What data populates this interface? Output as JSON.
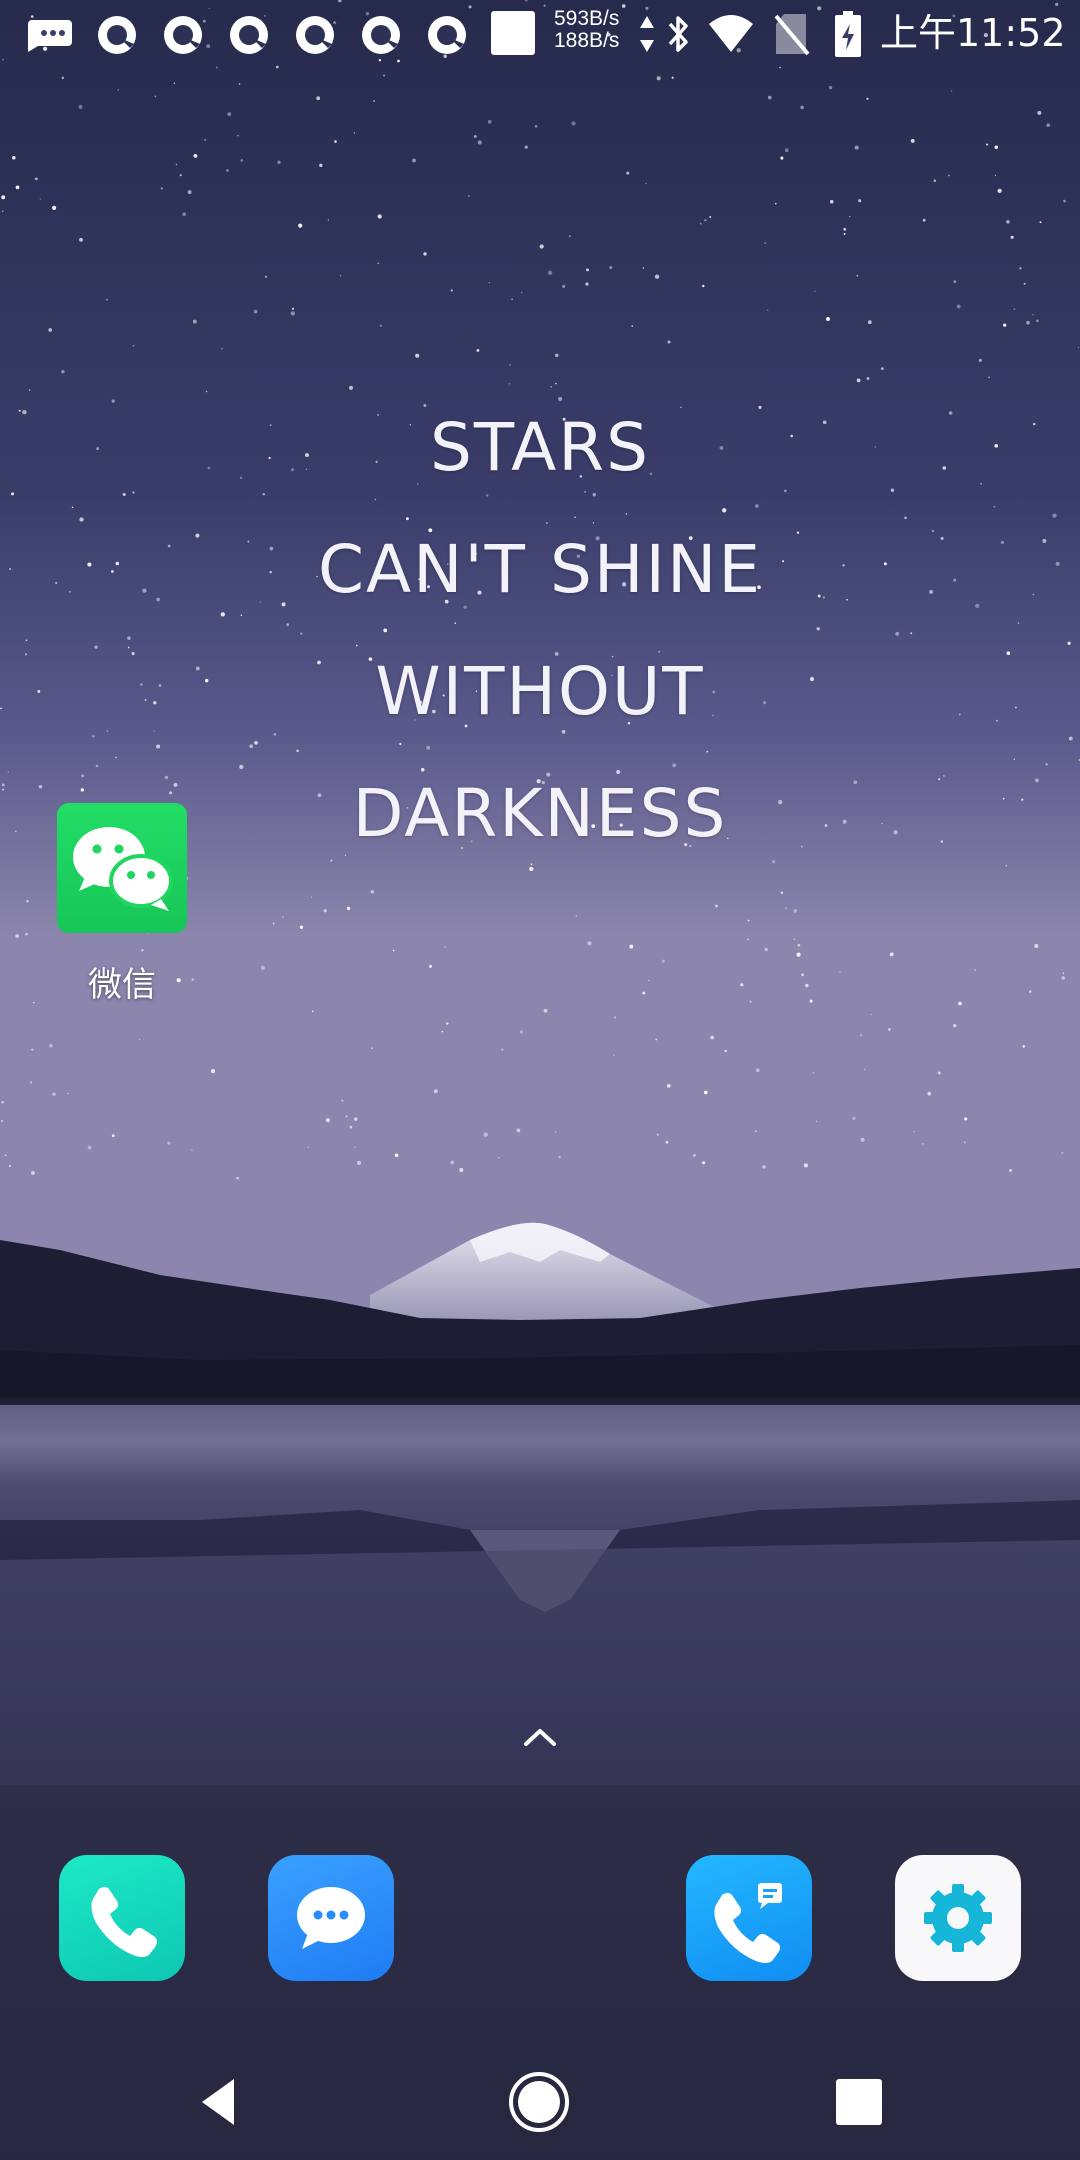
{
  "status_bar": {
    "net_up": "593B/s",
    "net_down": "188B/s",
    "time": "上午11:52",
    "icons": [
      "notification-icon",
      "app-notification-icon",
      "bluetooth-icon",
      "wifi-icon",
      "no-sim-icon",
      "battery-charging-icon"
    ]
  },
  "wallpaper_quote": {
    "line1": "STARS",
    "line2": "CAN'T SHINE",
    "line3": "WITHOUT",
    "line4": "DARKNESS"
  },
  "desktop": {
    "apps": [
      {
        "label": "微信",
        "icon": "wechat-icon"
      }
    ]
  },
  "dock": {
    "apps": [
      {
        "icon": "phone-icon"
      },
      {
        "icon": "messages-icon"
      },
      {
        "icon": "contacts-icon"
      },
      {
        "icon": "settings-icon"
      }
    ]
  },
  "nav_bar": {
    "buttons": [
      "back-icon",
      "home-icon",
      "recents-icon"
    ]
  },
  "colors": {
    "wechat_green": "#1fd65e",
    "phone_teal": "#12d6bb",
    "messages_blue": "#2a8cfa",
    "contacts_blue": "#18a2f8",
    "settings_cyan": "#16b6d8"
  }
}
